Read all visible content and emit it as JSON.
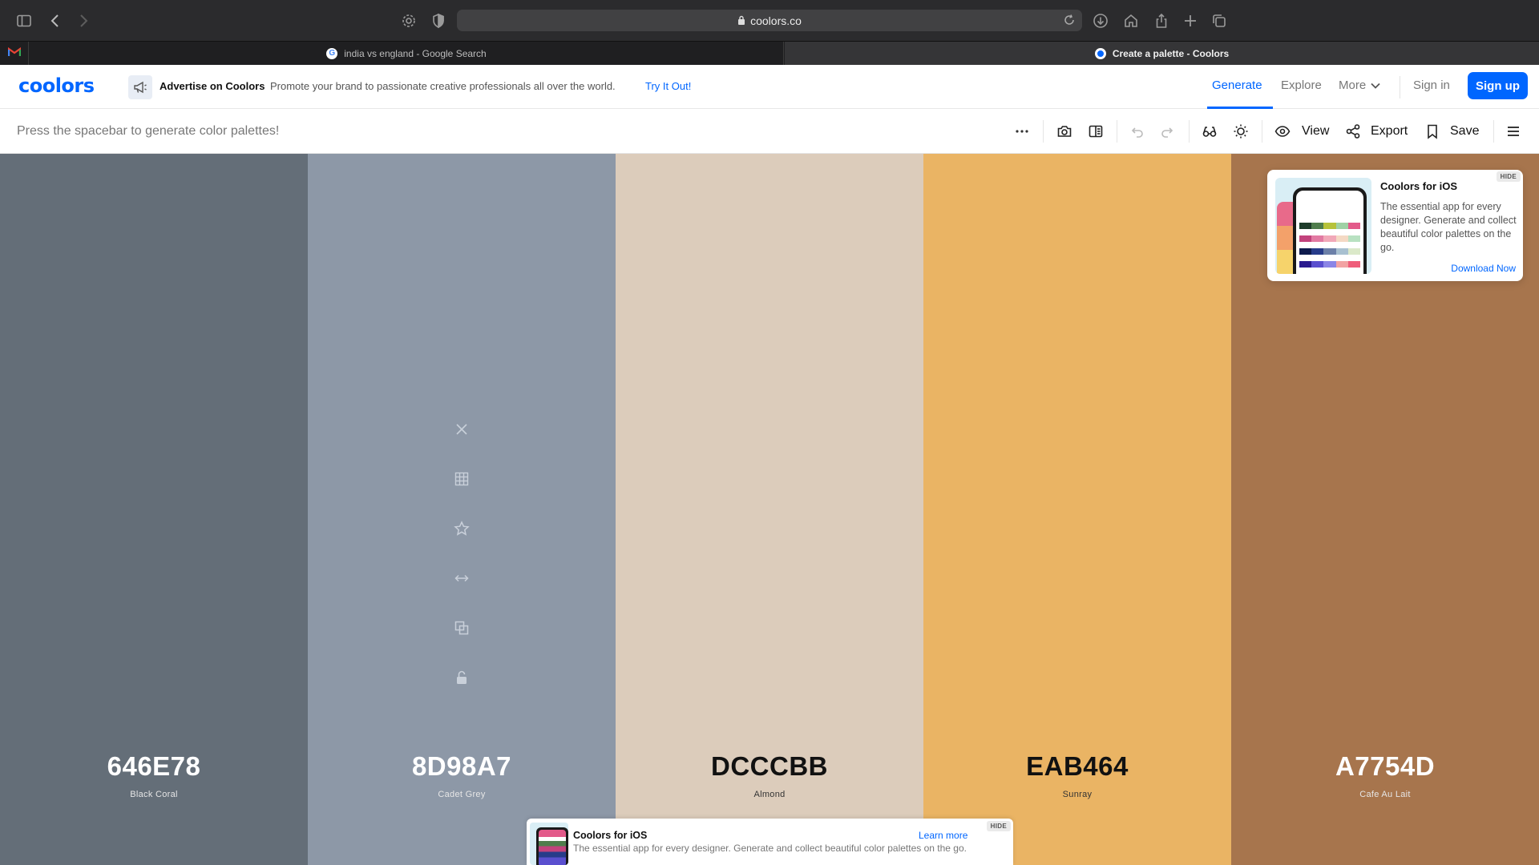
{
  "browser": {
    "url": "coolors.co",
    "tabs": [
      {
        "label": "india vs england - Google Search",
        "active": false
      },
      {
        "label": "Create a palette - Coolors",
        "active": true
      }
    ]
  },
  "header": {
    "logo": "coolors",
    "ad": {
      "title": "Advertise on Coolors",
      "text": "Promote your brand to passionate creative professionals all over the world.",
      "link": "Try It Out!"
    },
    "nav": {
      "generate": "Generate",
      "explore": "Explore",
      "more": "More",
      "signin": "Sign in",
      "signup": "Sign up"
    }
  },
  "toolbar": {
    "hint": "Press the spacebar to generate color palettes!",
    "view": "View",
    "export": "Export",
    "save": "Save"
  },
  "palette": [
    {
      "hex": "646E78",
      "name": "Black Coral",
      "color": "#646E78",
      "text": "light"
    },
    {
      "hex": "8D98A7",
      "name": "Cadet Grey",
      "color": "#8D98A7",
      "text": "light"
    },
    {
      "hex": "DCCCBB",
      "name": "Almond",
      "color": "#DCCCBB",
      "text": "dark"
    },
    {
      "hex": "EAB464",
      "name": "Sunray",
      "color": "#EAB464",
      "text": "dark"
    },
    {
      "hex": "A7754D",
      "name": "Cafe Au Lait",
      "color": "#A7754D",
      "text": "light"
    }
  ],
  "swatch_tools": [
    "close-icon",
    "grid-icon",
    "star-icon",
    "drag-arrows-icon",
    "copy-icon",
    "lock-icon"
  ],
  "promo_card": {
    "title": "Coolors for iOS",
    "text": "The essential app for every designer. Generate and collect beautiful color palettes on the go.",
    "link": "Download Now",
    "hide": "HIDE"
  },
  "bottom_promo": {
    "title": "Coolors for iOS",
    "text": "The essential app for every designer. Generate and collect beautiful color palettes on the go.",
    "link": "Learn more",
    "hide": "HIDE"
  },
  "colors": {
    "accent": "#0066ff",
    "chrome": "#2b2b2d"
  }
}
